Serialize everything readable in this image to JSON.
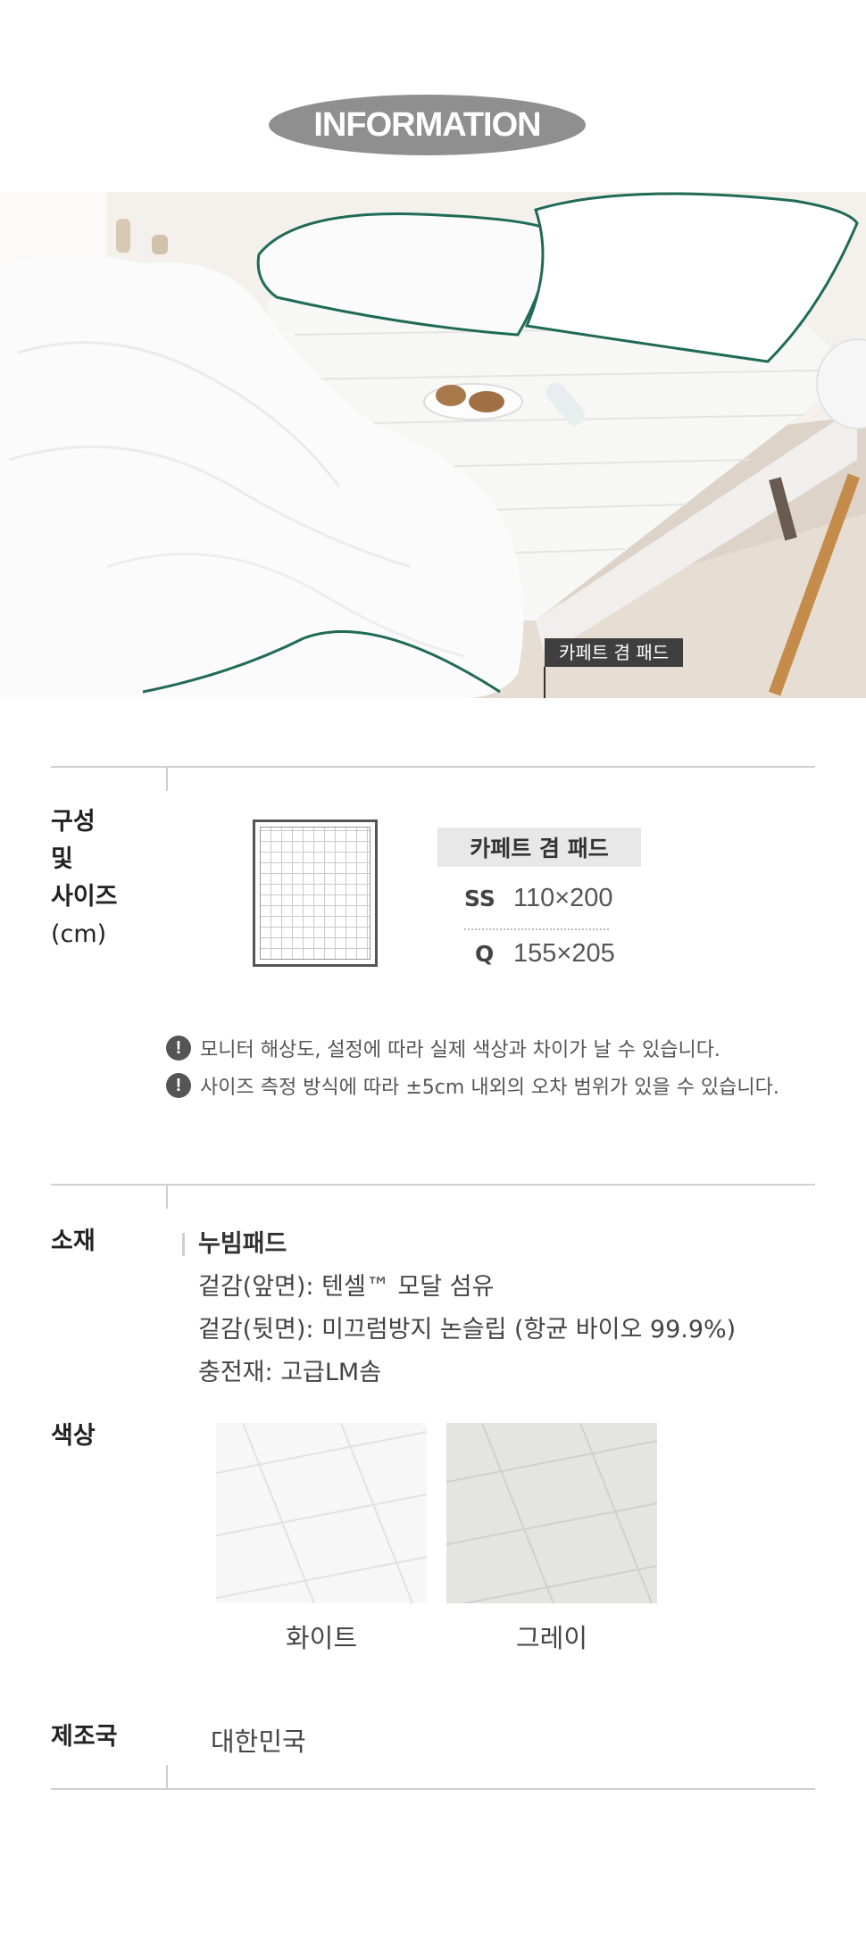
{
  "header": {
    "title": "INFORMATION"
  },
  "photo": {
    "tag_label": "카페트 겸 패드"
  },
  "composition": {
    "label_lines": [
      "구성",
      "및",
      "사이즈"
    ],
    "label_unit": "(cm)",
    "product_name": "카페트 겸 패드",
    "sizes": [
      {
        "code": "SS",
        "dim": "110×200"
      },
      {
        "code": "Q",
        "dim": "155×205"
      }
    ]
  },
  "notices": [
    "모니터 해상도, 설정에 따라 실제 색상과 차이가 날 수 있습니다.",
    "사이즈 측정 방식에 따라 ±5cm 내외의 오차 범위가 있을 수 있습니다."
  ],
  "notice_icon": "exclamation-circle-icon",
  "material": {
    "label": "소재",
    "head": "누빔패드",
    "lines": [
      "겉감(앞면): 텐셀™ 모달 섬유",
      "겉감(뒷면): 미끄럼방지 논슬립 (항균 바이오 99.9%)",
      "충전재: 고급LM솜"
    ]
  },
  "color": {
    "label": "색상",
    "options": [
      {
        "name": "화이트",
        "hex": "#f7f7f7"
      },
      {
        "name": "그레이",
        "hex": "#e4e4e2"
      }
    ]
  },
  "origin": {
    "label": "제조국",
    "value": "대한민국"
  },
  "colors": {
    "title_pill": "#8f8f8f",
    "rule": "#cfcfcf",
    "tag_bg": "#3f3f3f",
    "piping_green": "#1f6b56"
  }
}
